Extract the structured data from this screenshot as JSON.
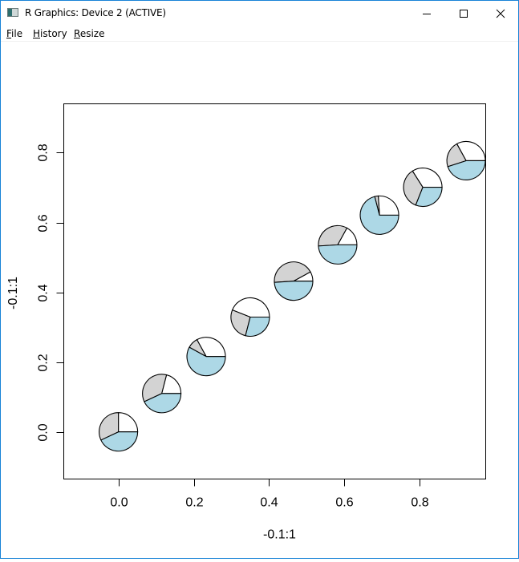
{
  "window": {
    "title": "R Graphics: Device 2 (ACTIVE)",
    "controls": {
      "minimize": "minimize-icon",
      "maximize": "maximize-icon",
      "close": "close-icon"
    }
  },
  "menubar": {
    "items": [
      {
        "label": "File",
        "accel": "F",
        "rest": "ile"
      },
      {
        "label": "History",
        "accel": "H",
        "rest": "istory"
      },
      {
        "label": "Resize",
        "accel": "R",
        "rest": "esize"
      }
    ]
  },
  "colors": {
    "slice_1": "#ffffff",
    "slice_2": "#d3d3d3",
    "slice_3": "#add8e6",
    "accent_border": "#1883d7"
  },
  "chart_data": {
    "type": "scatter",
    "marker": "pie",
    "title": "",
    "xlabel": "-0.1:1",
    "ylabel": "-0.1:1",
    "xlim": [
      -0.145,
      0.975
    ],
    "ylim": [
      -0.135,
      0.94
    ],
    "xticks": [
      0.0,
      0.2,
      0.4,
      0.6,
      0.8
    ],
    "xtick_labels": [
      "0.0",
      "0.2",
      "0.4",
      "0.6",
      "0.8"
    ],
    "yticks": [
      0.0,
      0.2,
      0.4,
      0.6,
      0.8
    ],
    "ytick_labels": [
      "0.0",
      "0.2",
      "0.4",
      "0.6",
      "0.8"
    ],
    "grid": false,
    "legend": "none",
    "slice_order": "counterclockwise from 0° (east)",
    "points": [
      {
        "x": 0.0,
        "y": 0.0,
        "slices": [
          0.25,
          0.32,
          0.43
        ]
      },
      {
        "x": 0.115,
        "y": 0.11,
        "slices": [
          0.21,
          0.36,
          0.43
        ]
      },
      {
        "x": 0.233,
        "y": 0.216,
        "slices": [
          0.33,
          0.09,
          0.58
        ]
      },
      {
        "x": 0.35,
        "y": 0.329,
        "slices": [
          0.44,
          0.27,
          0.29
        ]
      },
      {
        "x": 0.465,
        "y": 0.432,
        "slices": [
          0.08,
          0.43,
          0.49
        ]
      },
      {
        "x": 0.582,
        "y": 0.536,
        "slices": [
          0.17,
          0.34,
          0.49
        ]
      },
      {
        "x": 0.693,
        "y": 0.621,
        "slices": [
          0.26,
          0.03,
          0.71
        ]
      },
      {
        "x": 0.808,
        "y": 0.701,
        "slices": [
          0.34,
          0.35,
          0.31
        ]
      },
      {
        "x": 0.923,
        "y": 0.777,
        "slices": [
          0.33,
          0.22,
          0.45
        ]
      }
    ]
  }
}
